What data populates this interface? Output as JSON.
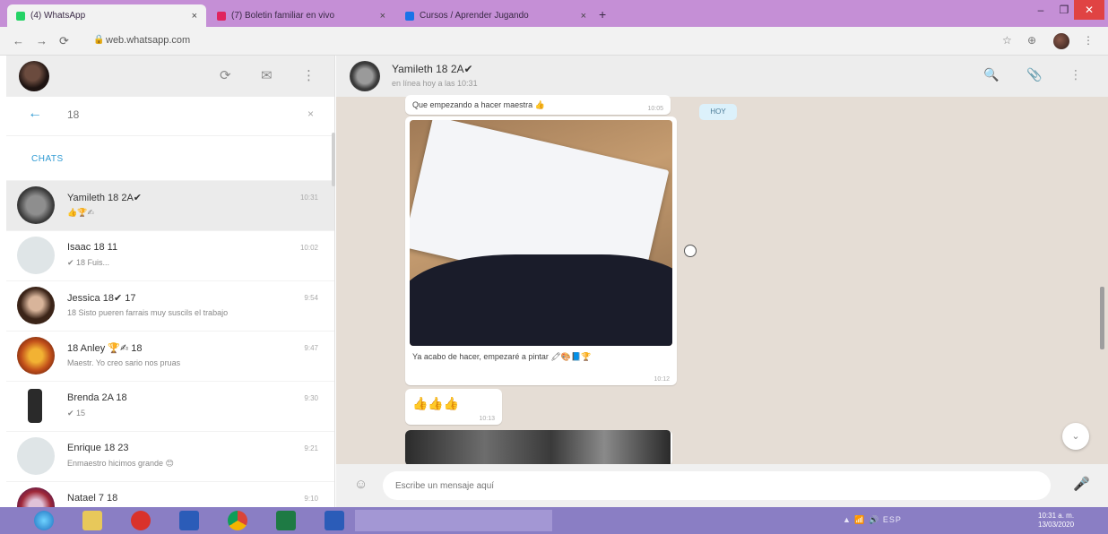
{
  "browser": {
    "tabs": [
      {
        "label": "(4) WhatsApp",
        "favicon_color": "#25d366",
        "close": "×"
      },
      {
        "label": "(7) Boletin familiar en vivo",
        "favicon_color": "#e0245e",
        "close": "×"
      },
      {
        "label": "Cursos / Aprender Jugando",
        "favicon_color": "#1a73e8",
        "close": "×"
      }
    ],
    "new_tab": "+",
    "window_controls": [
      "–",
      "❐",
      "✕"
    ],
    "nav": [
      "←",
      "→",
      "⟳"
    ],
    "lock": "🔒",
    "url": "web.whatsapp.com",
    "extensions": [
      "☆",
      "⊕",
      "⋮"
    ]
  },
  "sidebar": {
    "header_icons": [
      "⟳",
      "✉",
      "⋮"
    ],
    "search": {
      "back": "←",
      "value": "18",
      "clear": "×"
    },
    "section_label": "CHATS",
    "chats": [
      {
        "name": "Yamileth 18 2A✔",
        "preview": "👍🏆✍",
        "time": "10:31",
        "avatar": "#6a6a6a"
      },
      {
        "name": "Isaac 18 11",
        "preview": "✔ 18 Fuis...",
        "time": "10:02",
        "avatar": "#dfe5e7"
      },
      {
        "name": "Jessica 18✔ 17",
        "preview": "18 Sisto pueren farrais muy suscils el trabajo",
        "time": "9:54",
        "avatar": "#5a4030"
      },
      {
        "name": "18 Anley 🏆✍ 18",
        "preview": "Maestr. Yo creo sario nos pruas",
        "time": "9:47",
        "avatar": "#c25a1c"
      },
      {
        "name": "Brenda 2A 18",
        "preview": "✔ 15",
        "time": "9:30",
        "avatar": "#2b2b2b"
      },
      {
        "name": "Enrique 18 23",
        "preview": "Enmaestro hicimos grande 😊",
        "time": "9:21",
        "avatar": "#dfe5e7"
      },
      {
        "name": "Natael 7 18",
        "preview": "",
        "time": "9:10",
        "avatar": "#b0303a"
      }
    ]
  },
  "conversation": {
    "name": "Yamileth 18 2A✔",
    "subtitle": "en línea hoy a las 10:31",
    "header_icons": [
      "🔍",
      "📎",
      "⋮"
    ],
    "day_chip": "HOY",
    "messages": [
      {
        "text": "Que empezando a hacer maestra 👍",
        "time": "10:05"
      },
      {
        "caption": "Ya acabo de hacer, empezaré a pintar 🖍🎨📘🏆",
        "time": "10:12"
      },
      {
        "text": "👍👍👍",
        "time": "10:13"
      }
    ],
    "scroll_down": "⌄",
    "footer": {
      "emoji": "☺",
      "placeholder": "Escribe un mensaje aquí",
      "mic": "🎤"
    }
  },
  "taskbar": {
    "tray_text": "▲ 📶 🔊 ESP",
    "clock_time": "10:31 a. m.",
    "clock_date": "13/03/2020"
  }
}
